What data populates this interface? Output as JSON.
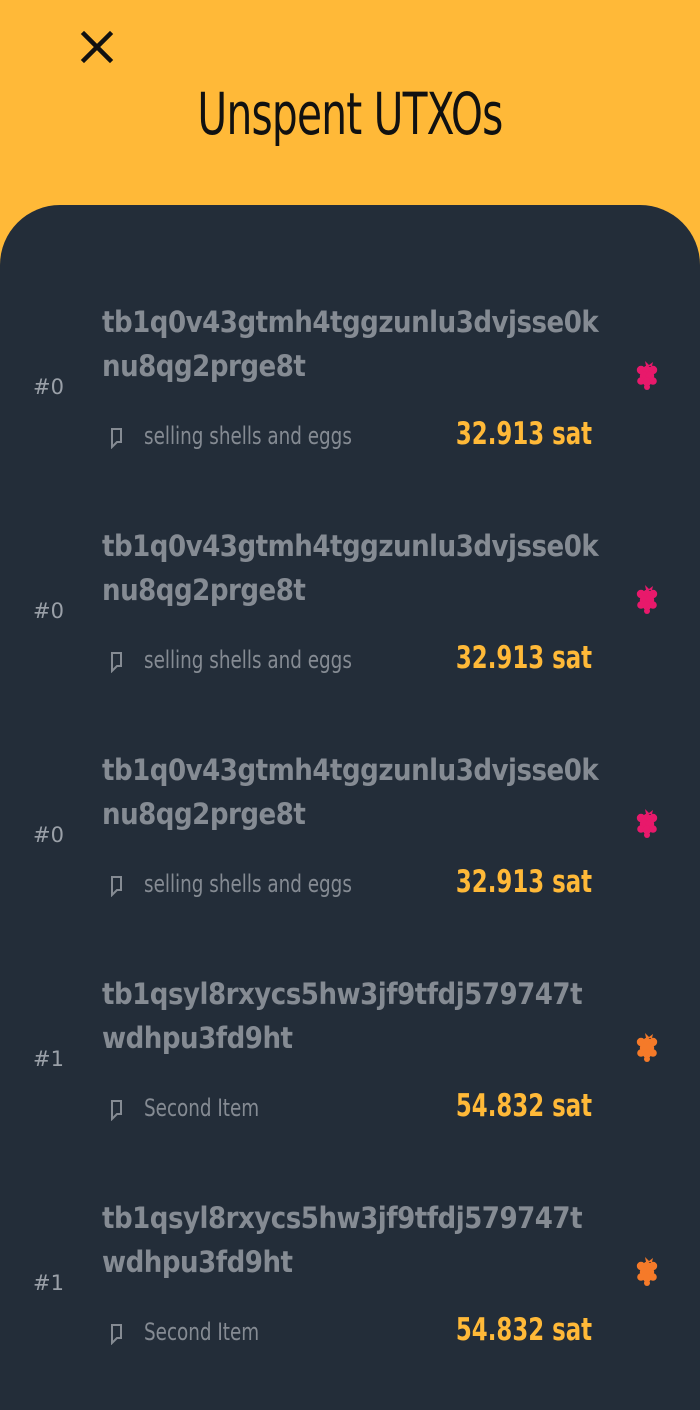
{
  "header": {
    "title": "Unspent UTXOs",
    "close_icon": "close-icon"
  },
  "colors": {
    "header_bg": "#FFB938",
    "panel_bg": "#232D39",
    "amount": "#FFB938",
    "text_muted": "#858B93",
    "grape_pink": "#E8196B",
    "grape_orange": "#F57A29"
  },
  "utxos": [
    {
      "index": "#0",
      "address": "tb1q0v43gtmh4tggzunlu3dvjsse0knu8qg2prge8t",
      "label": "selling shells and eggs",
      "amount": "32.913 sat",
      "icon": "grape-icon",
      "icon_color": "#E8196B"
    },
    {
      "index": "#0",
      "address": "tb1q0v43gtmh4tggzunlu3dvjsse0knu8qg2prge8t",
      "label": "selling shells and eggs",
      "amount": "32.913 sat",
      "icon": "grape-icon",
      "icon_color": "#E8196B"
    },
    {
      "index": "#0",
      "address": "tb1q0v43gtmh4tggzunlu3dvjsse0knu8qg2prge8t",
      "label": "selling shells and eggs",
      "amount": "32.913 sat",
      "icon": "grape-icon",
      "icon_color": "#E8196B"
    },
    {
      "index": "#1",
      "address": "tb1qsyl8rxycs5hw3jf9tfdj579747twdhpu3fd9ht",
      "label": "Second Item",
      "amount": "54.832 sat",
      "icon": "grape-icon",
      "icon_color": "#F57A29"
    },
    {
      "index": "#1",
      "address": "tb1qsyl8rxycs5hw3jf9tfdj579747twdhpu3fd9ht",
      "label": "Second Item",
      "amount": "54.832 sat",
      "icon": "grape-icon",
      "icon_color": "#F57A29"
    }
  ]
}
